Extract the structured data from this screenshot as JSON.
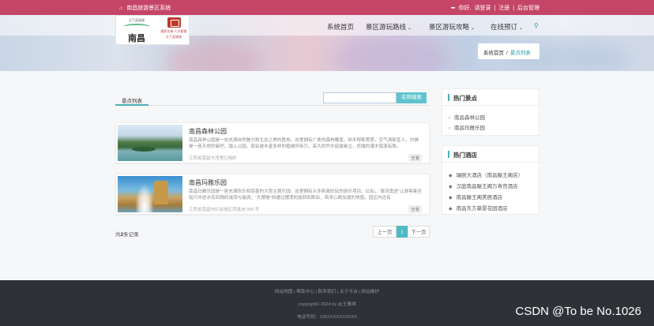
{
  "topbar": {
    "site_name": "南昌旅游景区系统",
    "greeting": "你好,",
    "login": "请登录",
    "separator1": "|",
    "register": "注册",
    "separator2": "|",
    "admin": "后台管理"
  },
  "logo": {
    "line1": "天下英雄城",
    "line2": "南昌",
    "line3": "國家名城 人文都會",
    "line4": "天下英雄城"
  },
  "nav": {
    "items": [
      {
        "label": "系统首页"
      },
      {
        "label": "景区游玩路线"
      },
      {
        "label": "景区游玩攻略"
      },
      {
        "label": "在线预订"
      }
    ]
  },
  "breadcrumb": {
    "home": "系统首页",
    "sep": "/",
    "current": "景点列表"
  },
  "list": {
    "tab_label": "景点列表",
    "search_placeholder": "",
    "search_button": "名称搜索",
    "items": [
      {
        "title": "南昌森林公园",
        "desc": "南昌森林公园是一处充满自然魅力和生态之美的胜地。这里拥有广袤的森林覆盖，树木郁郁葱葱，空气清新宜人。仿佛是一座天然的氧吧，踏入公园，就会被丰富多样的植被所吸引，高大的乔木挺拔耸立，低矮的灌木错落有致，",
        "addr": "江西省南昌市湾里区梅岭",
        "tag": "查看"
      },
      {
        "title": "南昌玛雅乐园",
        "desc": "南昌玛雅乐园是一座充满欢乐和惊喜的大型主题乐园。这里拥有众多刺激好玩的游乐项目，比如，\"激流勇进\"让游客乘坐船只冲进水花四溅的湍流与漩涡；\"大摆锤\"则通过摆荡的旋转和跌宕，带来心跳加速的快感。园区内还有",
        "addr": "江西省南昌市红谷滩区凤凰洲 999 号",
        "tag": "查看"
      }
    ],
    "count_prefix": "共",
    "count_value": "2",
    "count_suffix": "条记录",
    "pager": {
      "prev": "上一页",
      "current": "1",
      "next": "下一页"
    }
  },
  "sidebar": {
    "hot_spots_title": "热门景点",
    "hot_spots": [
      "南昌森林公园",
      "南昌玛雅乐园"
    ],
    "hot_hotels_title": "热门酒店",
    "hot_hotels": [
      "瑞颐大酒店（南昌滕王阁店）",
      "汉庭南昌滕王阁万寿宫酒店",
      "南昌滕王阁美居酒店",
      "南昌东方豪景花园酒店"
    ]
  },
  "footer": {
    "links": "网站地图 | 帮助中心 | 联系我们 | 关于平台 | 网站维护",
    "copyright": "copyright© 2024 by @王雅琪",
    "phone": "电话号码：136XXXXXXXXXX"
  },
  "watermark": "CSDN @To be No.1026",
  "colors": {
    "topbar": "#c54567",
    "accent": "#4fb9c5",
    "footer": "#2f3137"
  }
}
